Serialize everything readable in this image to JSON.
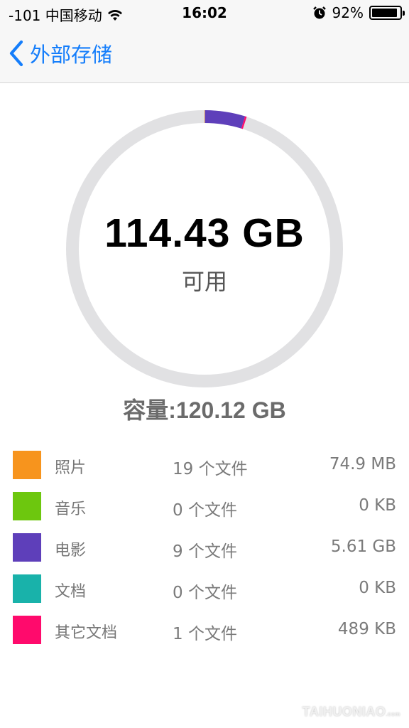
{
  "status_bar": {
    "carrier": "-101 中国移动",
    "time": "16:02",
    "battery_text": "92%",
    "battery_level": 0.92,
    "icons": [
      "wifi-icon",
      "alarm-icon",
      "battery-icon"
    ]
  },
  "nav": {
    "back_label": "外部存储",
    "accent": "#157efb"
  },
  "storage": {
    "free_value": "114.43 GB",
    "free_label": "可用",
    "capacity_text": "容量:120.12 GB",
    "ring_track_color": "#e1e1e3"
  },
  "categories": [
    {
      "name": "照片",
      "count": "19 个文件",
      "size": "74.9 MB",
      "color": "#f7941d",
      "fraction": 0.0006
    },
    {
      "name": "音乐",
      "count": "0 个文件",
      "size": "0 KB",
      "color": "#6dc70e",
      "fraction": 0
    },
    {
      "name": "电影",
      "count": "9 个文件",
      "size": "5.61 GB",
      "color": "#5e3fba",
      "fraction": 0.0467
    },
    {
      "name": "文档",
      "count": "0 个文件",
      "size": "0 KB",
      "color": "#19b2aa",
      "fraction": 0
    },
    {
      "name": "其它文档",
      "count": "1 个文件",
      "size": "489 KB",
      "color": "#ff0a6c",
      "fraction": 0.002
    }
  ],
  "watermark": {
    "text": "TAIHUONIAO",
    "sub": ".com"
  }
}
